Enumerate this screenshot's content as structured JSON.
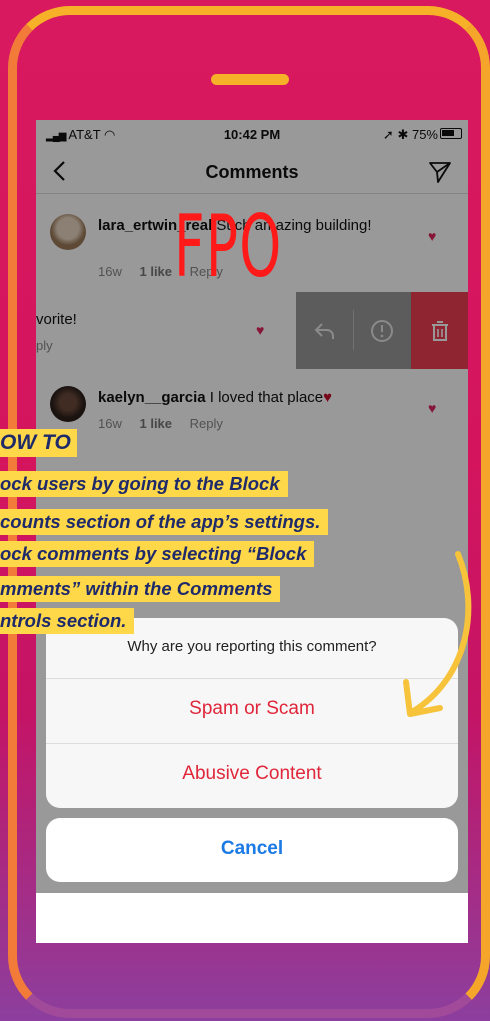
{
  "status_bar": {
    "carrier": "AT&T",
    "time": "10:42 PM",
    "battery": "75%"
  },
  "nav": {
    "title": "Comments"
  },
  "comments": [
    {
      "username": "lara_ertwin_real",
      "text": " Such amazing building!",
      "age": "16w",
      "likes": "1 like",
      "reply": "Reply"
    },
    {
      "text": "vorite!",
      "reply": "ply"
    },
    {
      "username": "kaelyn__garcia",
      "text": " I loved that place",
      "age": "16w",
      "likes": "1 like",
      "reply": "Reply"
    }
  ],
  "action_sheet": {
    "title": "Why are you reporting this comment?",
    "options": [
      "Spam or Scam",
      "Abusive Content"
    ],
    "cancel": "Cancel"
  },
  "overlay": {
    "fpo": "FPO",
    "howto_title": "OW TO",
    "howto_lines": [
      "ock users by going to the Block",
      "counts section of the app’s settings.",
      "ock comments by selecting “Block",
      "mments” within the Comments",
      "ntrols section."
    ]
  },
  "colors": {
    "background": "#d8195f",
    "frame": "#f6b128",
    "callout_bg": "#ffd84a",
    "callout_text": "#1e2a6a",
    "destructive": "#e0263a",
    "cancel": "#1c7ae5",
    "fpo": "#ff1a1a"
  },
  "icons": [
    "signal-icon",
    "wifi-icon",
    "location-icon",
    "bluetooth-icon",
    "battery-icon",
    "back-icon",
    "send-icon",
    "heart-icon",
    "reply-icon",
    "report-icon",
    "trash-icon",
    "arrow-icon"
  ]
}
